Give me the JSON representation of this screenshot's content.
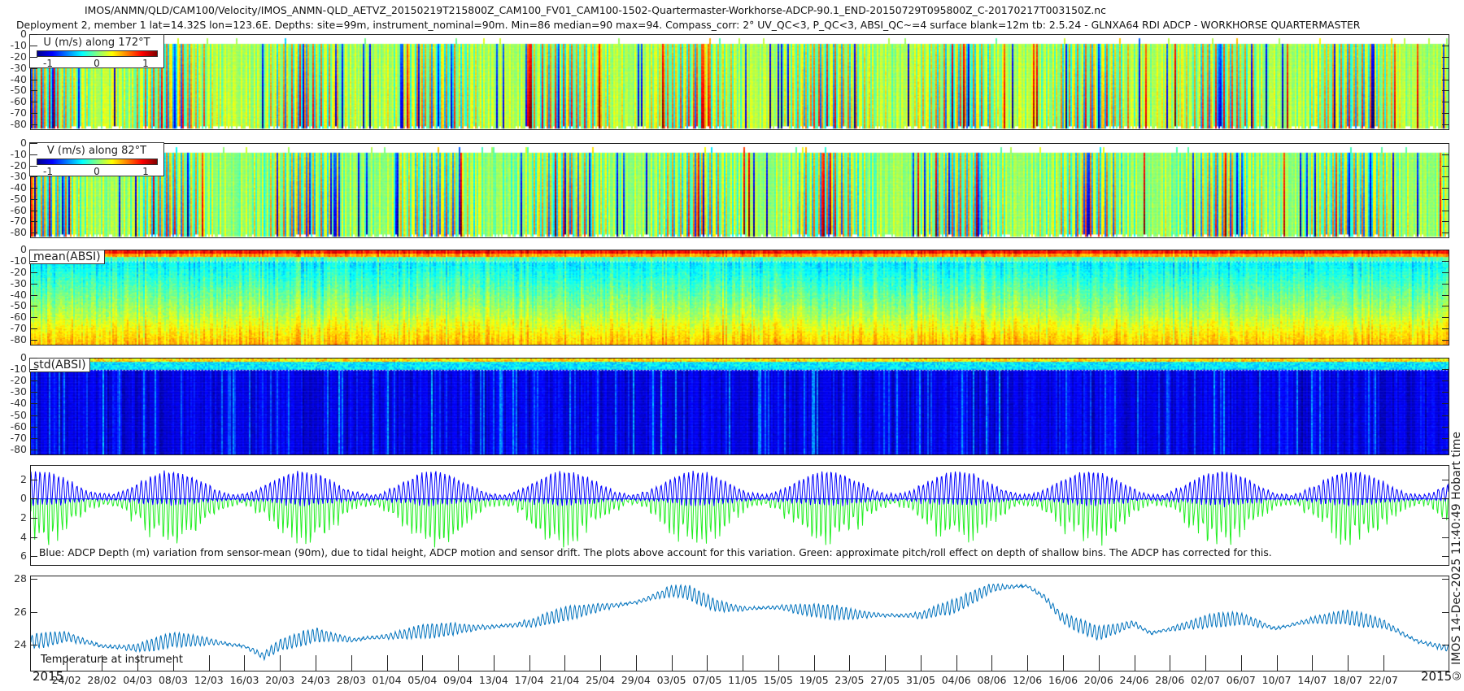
{
  "title": {
    "line1": "IMOS/ANMN/QLD/CAM100/Velocity/IMOS_ANMN-QLD_AETVZ_20150219T215800Z_CAM100_FV01_CAM100-1502-Quartermaster-Workhorse-ADCP-90.1_END-20150729T095800Z_C-20170217T003150Z.nc",
    "line2": "Deployment 2, member 1 lat=14.32S lon=123.6E. Depths: site=99m, instrument_nominal=90m. Min=86 median=90 max=94. Compass_corr: 2° UV_QC<3, P_QC<3, ABSI_QC~=4 surface blank=12m tb: 2.5.24 - GLNXA64 RDI ADCP - WORKHORSE QUARTERMASTER"
  },
  "credit": "© IMOS 14-Dec-2025 11:40:49 Hobart time",
  "xaxis": {
    "start": "2015-02-19T21:58",
    "end": "2015-07-29T09:58",
    "year_left": "2015",
    "year_right": "2015",
    "tick_labels": [
      "24/02",
      "28/02",
      "04/03",
      "08/03",
      "12/03",
      "16/03",
      "20/03",
      "24/03",
      "28/03",
      "01/04",
      "05/04",
      "09/04",
      "13/04",
      "17/04",
      "21/04",
      "25/04",
      "29/04",
      "03/05",
      "07/05",
      "11/05",
      "15/05",
      "19/05",
      "23/05",
      "27/05",
      "31/05",
      "04/06",
      "08/06",
      "12/06",
      "16/06",
      "20/06",
      "24/06",
      "28/06",
      "02/07",
      "06/07",
      "10/07",
      "14/07",
      "18/07",
      "22/07"
    ]
  },
  "chart_data": [
    {
      "type": "heatmap",
      "id": "u",
      "legend_title": "U (m/s) along 172°T",
      "colormap": "jet",
      "clim": [
        -1.25,
        1.25
      ],
      "colorbar_ticks": [
        "-1",
        "0",
        "1"
      ],
      "ylim": [
        0,
        85
      ],
      "y_reversed": true,
      "yticks": [
        "0",
        "-10",
        "-20",
        "-30",
        "-40",
        "-50",
        "-60",
        "-70",
        "-80"
      ],
      "data_depth_range": [
        8,
        84
      ]
    },
    {
      "type": "heatmap",
      "id": "v",
      "legend_title": "V (m/s) along 82°T",
      "colormap": "jet",
      "clim": [
        -1.25,
        1.25
      ],
      "colorbar_ticks": [
        "-1",
        "0",
        "1"
      ],
      "ylim": [
        0,
        85
      ],
      "y_reversed": true,
      "yticks": [
        "0",
        "-10",
        "-20",
        "-30",
        "-40",
        "-50",
        "-60",
        "-70",
        "-80"
      ],
      "data_depth_range": [
        8,
        84
      ]
    },
    {
      "type": "heatmap",
      "id": "mean_absi",
      "label": "mean(ABSI)",
      "colormap": "jet",
      "ylim": [
        0,
        85
      ],
      "y_reversed": true,
      "yticks": [
        "0",
        "-10",
        "-20",
        "-30",
        "-40",
        "-50",
        "-60",
        "-70",
        "-80"
      ]
    },
    {
      "type": "heatmap",
      "id": "std_absi",
      "label": "std(ABSI)",
      "colormap": "jet",
      "ylim": [
        0,
        85
      ],
      "y_reversed": true,
      "yticks": [
        "0",
        "-10",
        "-20",
        "-30",
        "-40",
        "-50",
        "-60",
        "-70",
        "-80"
      ]
    },
    {
      "type": "line",
      "id": "depth_variation",
      "ylim": [
        -3.5,
        7
      ],
      "y_reversed": true,
      "yticks": [
        {
          "v": -2,
          "label": "2"
        },
        {
          "v": 0,
          "label": "0"
        },
        {
          "v": 2,
          "label": "2"
        },
        {
          "v": 4,
          "label": "4"
        },
        {
          "v": 6,
          "label": "6"
        }
      ],
      "annotation": "Blue: ADCP Depth (m) variation from sensor-mean (90m), due to tidal height, ADCP motion and sensor drift. The plots above account for this variation. Green: approximate pitch/roll effect on depth of shallow bins. The ADCP has corrected for this.",
      "series": [
        {
          "color": "#0000ff",
          "max_abs_m": 3.5
        },
        {
          "color": "#22ee22",
          "max_m": 6.5
        }
      ]
    },
    {
      "type": "line",
      "id": "temperature",
      "label": "Temperature at instrument",
      "color": "#0072bd",
      "ylim": [
        22.4,
        28.2
      ],
      "yticks": [
        {
          "v": 24,
          "label": "24"
        },
        {
          "v": 26,
          "label": "26"
        },
        {
          "v": 28,
          "label": "28"
        }
      ],
      "trend": [
        [
          "19/02",
          24.1
        ],
        [
          "24/02",
          24.5
        ],
        [
          "28/02",
          23.9
        ],
        [
          "04/03",
          23.8
        ],
        [
          "08/03",
          24.3
        ],
        [
          "12/03",
          24.2
        ],
        [
          "16/03",
          23.9
        ],
        [
          "18/03",
          23.3
        ],
        [
          "20/03",
          24.0
        ],
        [
          "24/03",
          24.6
        ],
        [
          "28/03",
          24.3
        ],
        [
          "01/04",
          24.5
        ],
        [
          "05/04",
          24.8
        ],
        [
          "09/04",
          25.0
        ],
        [
          "13/04",
          25.1
        ],
        [
          "17/04",
          25.3
        ],
        [
          "21/04",
          25.9
        ],
        [
          "25/04",
          26.3
        ],
        [
          "29/04",
          26.6
        ],
        [
          "03/05",
          27.3
        ],
        [
          "05/05",
          27.2
        ],
        [
          "08/05",
          26.4
        ],
        [
          "11/05",
          26.2
        ],
        [
          "15/05",
          26.3
        ],
        [
          "19/05",
          26.1
        ],
        [
          "23/05",
          25.9
        ],
        [
          "27/05",
          25.8
        ],
        [
          "31/05",
          25.8
        ],
        [
          "04/06",
          26.4
        ],
        [
          "08/06",
          27.5
        ],
        [
          "12/06",
          27.6
        ],
        [
          "14/06",
          26.9
        ],
        [
          "16/06",
          25.6
        ],
        [
          "20/06",
          24.7
        ],
        [
          "24/06",
          25.3
        ],
        [
          "26/06",
          24.7
        ],
        [
          "30/06",
          25.2
        ],
        [
          "03/07",
          25.5
        ],
        [
          "06/07",
          25.6
        ],
        [
          "10/07",
          25.0
        ],
        [
          "14/07",
          25.5
        ],
        [
          "18/07",
          25.7
        ],
        [
          "22/07",
          25.3
        ],
        [
          "26/07",
          24.2
        ],
        [
          "29/07",
          23.8
        ]
      ]
    }
  ]
}
